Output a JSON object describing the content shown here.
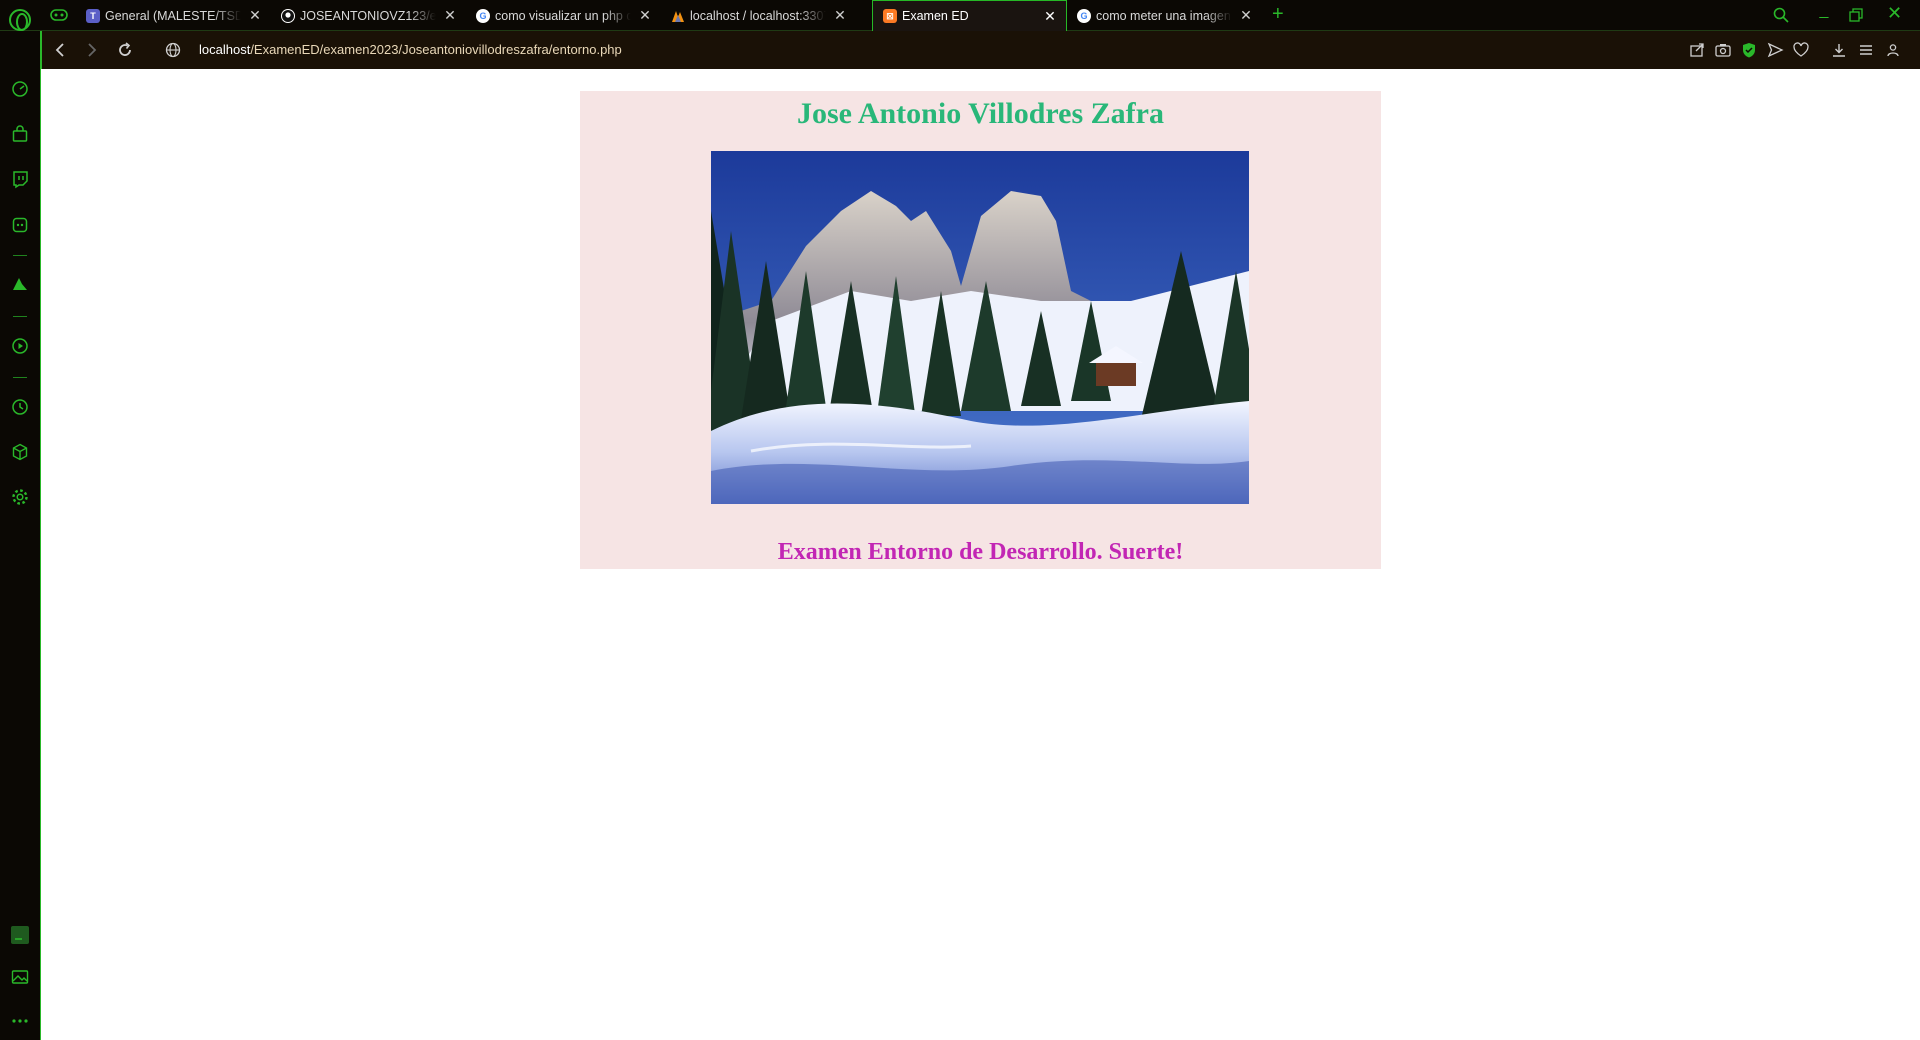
{
  "browser": {
    "tabs": [
      {
        "title": "General (MALESTE/TSDAM",
        "favicon": "teams-icon",
        "favicon_color": "#5b5fc7",
        "active": false
      },
      {
        "title": "JOSEANTONIOVZ123/exam",
        "favicon": "github-icon",
        "favicon_color": "#ffffff",
        "active": false
      },
      {
        "title": "como visualizar un php de",
        "favicon": "google-icon",
        "favicon_color": "#ffffff",
        "active": false
      },
      {
        "title": "localhost / localhost:3307 |",
        "favicon": "phpmyadmin-icon",
        "favicon_color": "#f29111",
        "active": false
      },
      {
        "title": "Examen ED",
        "favicon": "xampp-icon",
        "favicon_color": "#fb7a24",
        "active": true
      },
      {
        "title": "como meter una imagen en",
        "favicon": "google-icon",
        "favicon_color": "#ffffff",
        "active": false
      }
    ],
    "new_tab_symbol": "+",
    "address": {
      "host": "localhost",
      "path": "/ExamenED/examen2023/Joseantoniovillodreszafra/entorno.php"
    },
    "accent_color": "#2ab82a"
  },
  "page": {
    "heading": "Jose Antonio Villodres Zafra",
    "footer_message": "Examen Entorno de Desarrollo. Suerte!",
    "heading_color": "#29b779",
    "footer_color": "#c226b4",
    "box_background": "#f6e4e4",
    "image_subject": "snowy-mountains-photo"
  }
}
